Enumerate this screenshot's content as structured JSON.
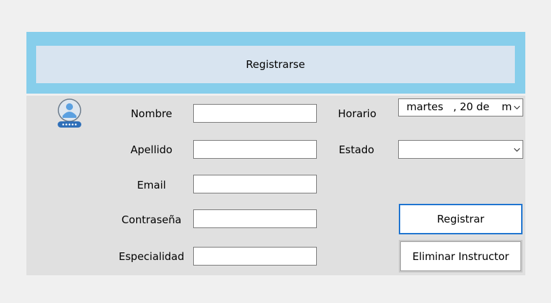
{
  "header": {
    "title": "Registrarse"
  },
  "icons": {
    "user": "user-id-card-icon",
    "chevron": "chevron-down-icon"
  },
  "colors": {
    "header_bg": "#87ceeb",
    "title_bg": "#d8e4f0",
    "form_bg": "#e0e0e0",
    "primary_border": "#1e74d0"
  },
  "form": {
    "nombre_label": "Nombre",
    "apellido_label": "Apellido",
    "email_label": "Email",
    "contrasena_label": "Contraseña",
    "especialidad_label": "Especialidad",
    "horario_label": "Horario",
    "estado_label": "Estado",
    "nombre_value": "",
    "apellido_value": "",
    "email_value": "",
    "contrasena_value": "",
    "especialidad_value": "",
    "horario_value": "martes   , 20 de",
    "horario_value_tail": "m",
    "estado_value": ""
  },
  "buttons": {
    "registrar": "Registrar",
    "eliminar": "Eliminar Instructor"
  }
}
